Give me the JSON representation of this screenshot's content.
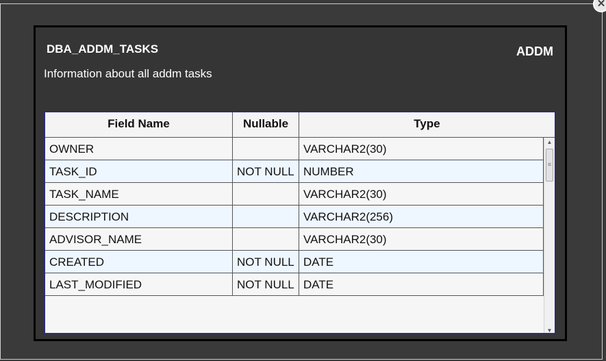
{
  "dialog": {
    "close_glyph": "✕",
    "title": "DBA_ADDM_TASKS",
    "brand": "ADDM",
    "subtitle": "Information about all addm tasks"
  },
  "table": {
    "headers": [
      "Field Name",
      "Nullable",
      "Type"
    ],
    "rows": [
      {
        "field": "OWNER",
        "nullable": "",
        "type": "VARCHAR2(30)"
      },
      {
        "field": "TASK_ID",
        "nullable": "NOT NULL",
        "type": "NUMBER"
      },
      {
        "field": "TASK_NAME",
        "nullable": "",
        "type": "VARCHAR2(30)"
      },
      {
        "field": "DESCRIPTION",
        "nullable": "",
        "type": "VARCHAR2(256)"
      },
      {
        "field": "ADVISOR_NAME",
        "nullable": "",
        "type": "VARCHAR2(30)"
      },
      {
        "field": "CREATED",
        "nullable": "NOT NULL",
        "type": "DATE"
      },
      {
        "field": "LAST_MODIFIED",
        "nullable": "NOT NULL",
        "type": "DATE"
      }
    ]
  },
  "scrollbar": {
    "up_glyph": "▲",
    "down_glyph": "▼",
    "thumb_glyph": "≡"
  }
}
